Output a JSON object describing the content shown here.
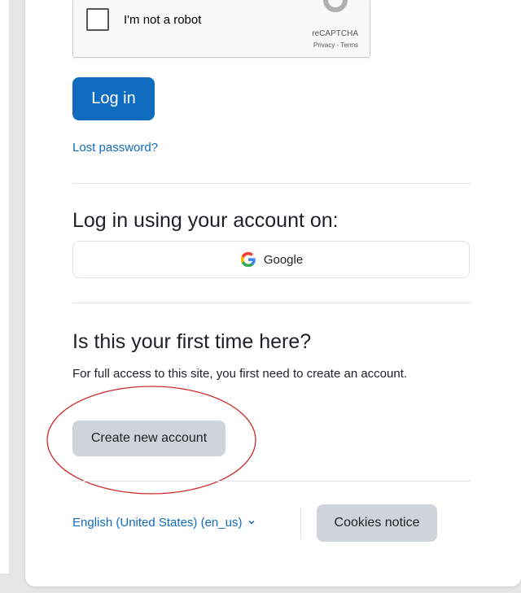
{
  "recaptcha": {
    "label": "I'm not a robot",
    "brand": "reCAPTCHA",
    "links": "Privacy - Terms"
  },
  "login": {
    "button_label": "Log in",
    "lost_password": "Lost password?"
  },
  "oauth": {
    "heading": "Log in using your account on:",
    "google_label": "Google"
  },
  "signup": {
    "heading": "Is this your first time here?",
    "description": "For full access to this site, you first need to create an account.",
    "button_label": "Create new account"
  },
  "footer": {
    "language": "English (United States) (en_us)",
    "cookies_label": "Cookies notice"
  },
  "colors": {
    "primary": "#0f6cbf",
    "secondary_button": "#ced4da",
    "annotation": "#cc2b2b"
  }
}
